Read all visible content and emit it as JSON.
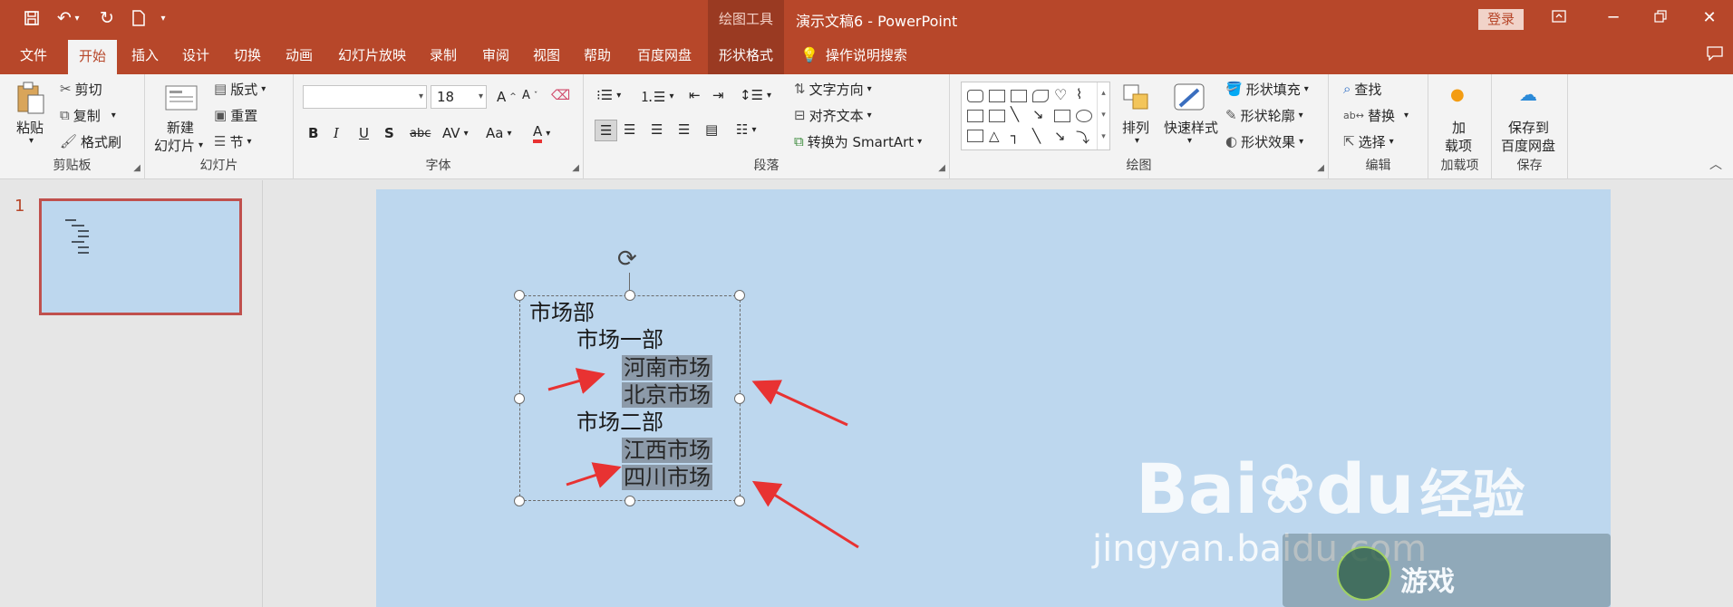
{
  "titlebar": {
    "drawing_tools": "绘图工具",
    "title": "演示文稿6 - PowerPoint",
    "login": "登录"
  },
  "tabs": [
    {
      "label": "文件"
    },
    {
      "label": "开始"
    },
    {
      "label": "插入"
    },
    {
      "label": "设计"
    },
    {
      "label": "切换"
    },
    {
      "label": "动画"
    },
    {
      "label": "幻灯片放映"
    },
    {
      "label": "录制"
    },
    {
      "label": "审阅"
    },
    {
      "label": "视图"
    },
    {
      "label": "帮助"
    },
    {
      "label": "百度网盘"
    },
    {
      "label": "形状格式"
    }
  ],
  "tell_me": "操作说明搜索",
  "ribbon": {
    "clipboard": {
      "paste": "粘贴",
      "cut": "剪切",
      "copy": "复制",
      "painter": "格式刷",
      "label": "剪贴板"
    },
    "slides": {
      "new": "新建",
      "new2": "幻灯片",
      "layout": "版式",
      "reset": "重置",
      "section": "节",
      "label": "幻灯片"
    },
    "font": {
      "name": "",
      "size": "18",
      "label": "字体"
    },
    "paragraph": {
      "direction": "文字方向",
      "align": "对齐文本",
      "smartart": "转换为 SmartArt",
      "label": "段落"
    },
    "drawing": {
      "arrange": "排列",
      "quick": "快速样式",
      "fill": "形状填充",
      "outline": "形状轮廓",
      "effects": "形状效果",
      "label": "绘图"
    },
    "editing": {
      "find": "查找",
      "replace": "替换",
      "select": "选择",
      "label": "编辑"
    },
    "addins": {
      "l1": "加",
      "l2": "载项",
      "label": "加载项"
    },
    "save": {
      "l1": "保存到",
      "l2": "百度网盘",
      "label": "保存"
    }
  },
  "slide_panel": {
    "number": "1"
  },
  "slide": {
    "lines": [
      "市场部",
      "市场一部",
      "河南市场",
      "北京市场",
      "市场二部",
      "江西市场",
      "四川市场"
    ]
  },
  "watermark": {
    "brand": "Bai",
    "brand2": "du",
    "jingyan": "经验",
    "url": "jingyan.baidu.com",
    "game": "游戏"
  },
  "colors": {
    "accent": "#b7472a",
    "slide_bg": "#bdd7ee",
    "arrow": "#e83232"
  }
}
